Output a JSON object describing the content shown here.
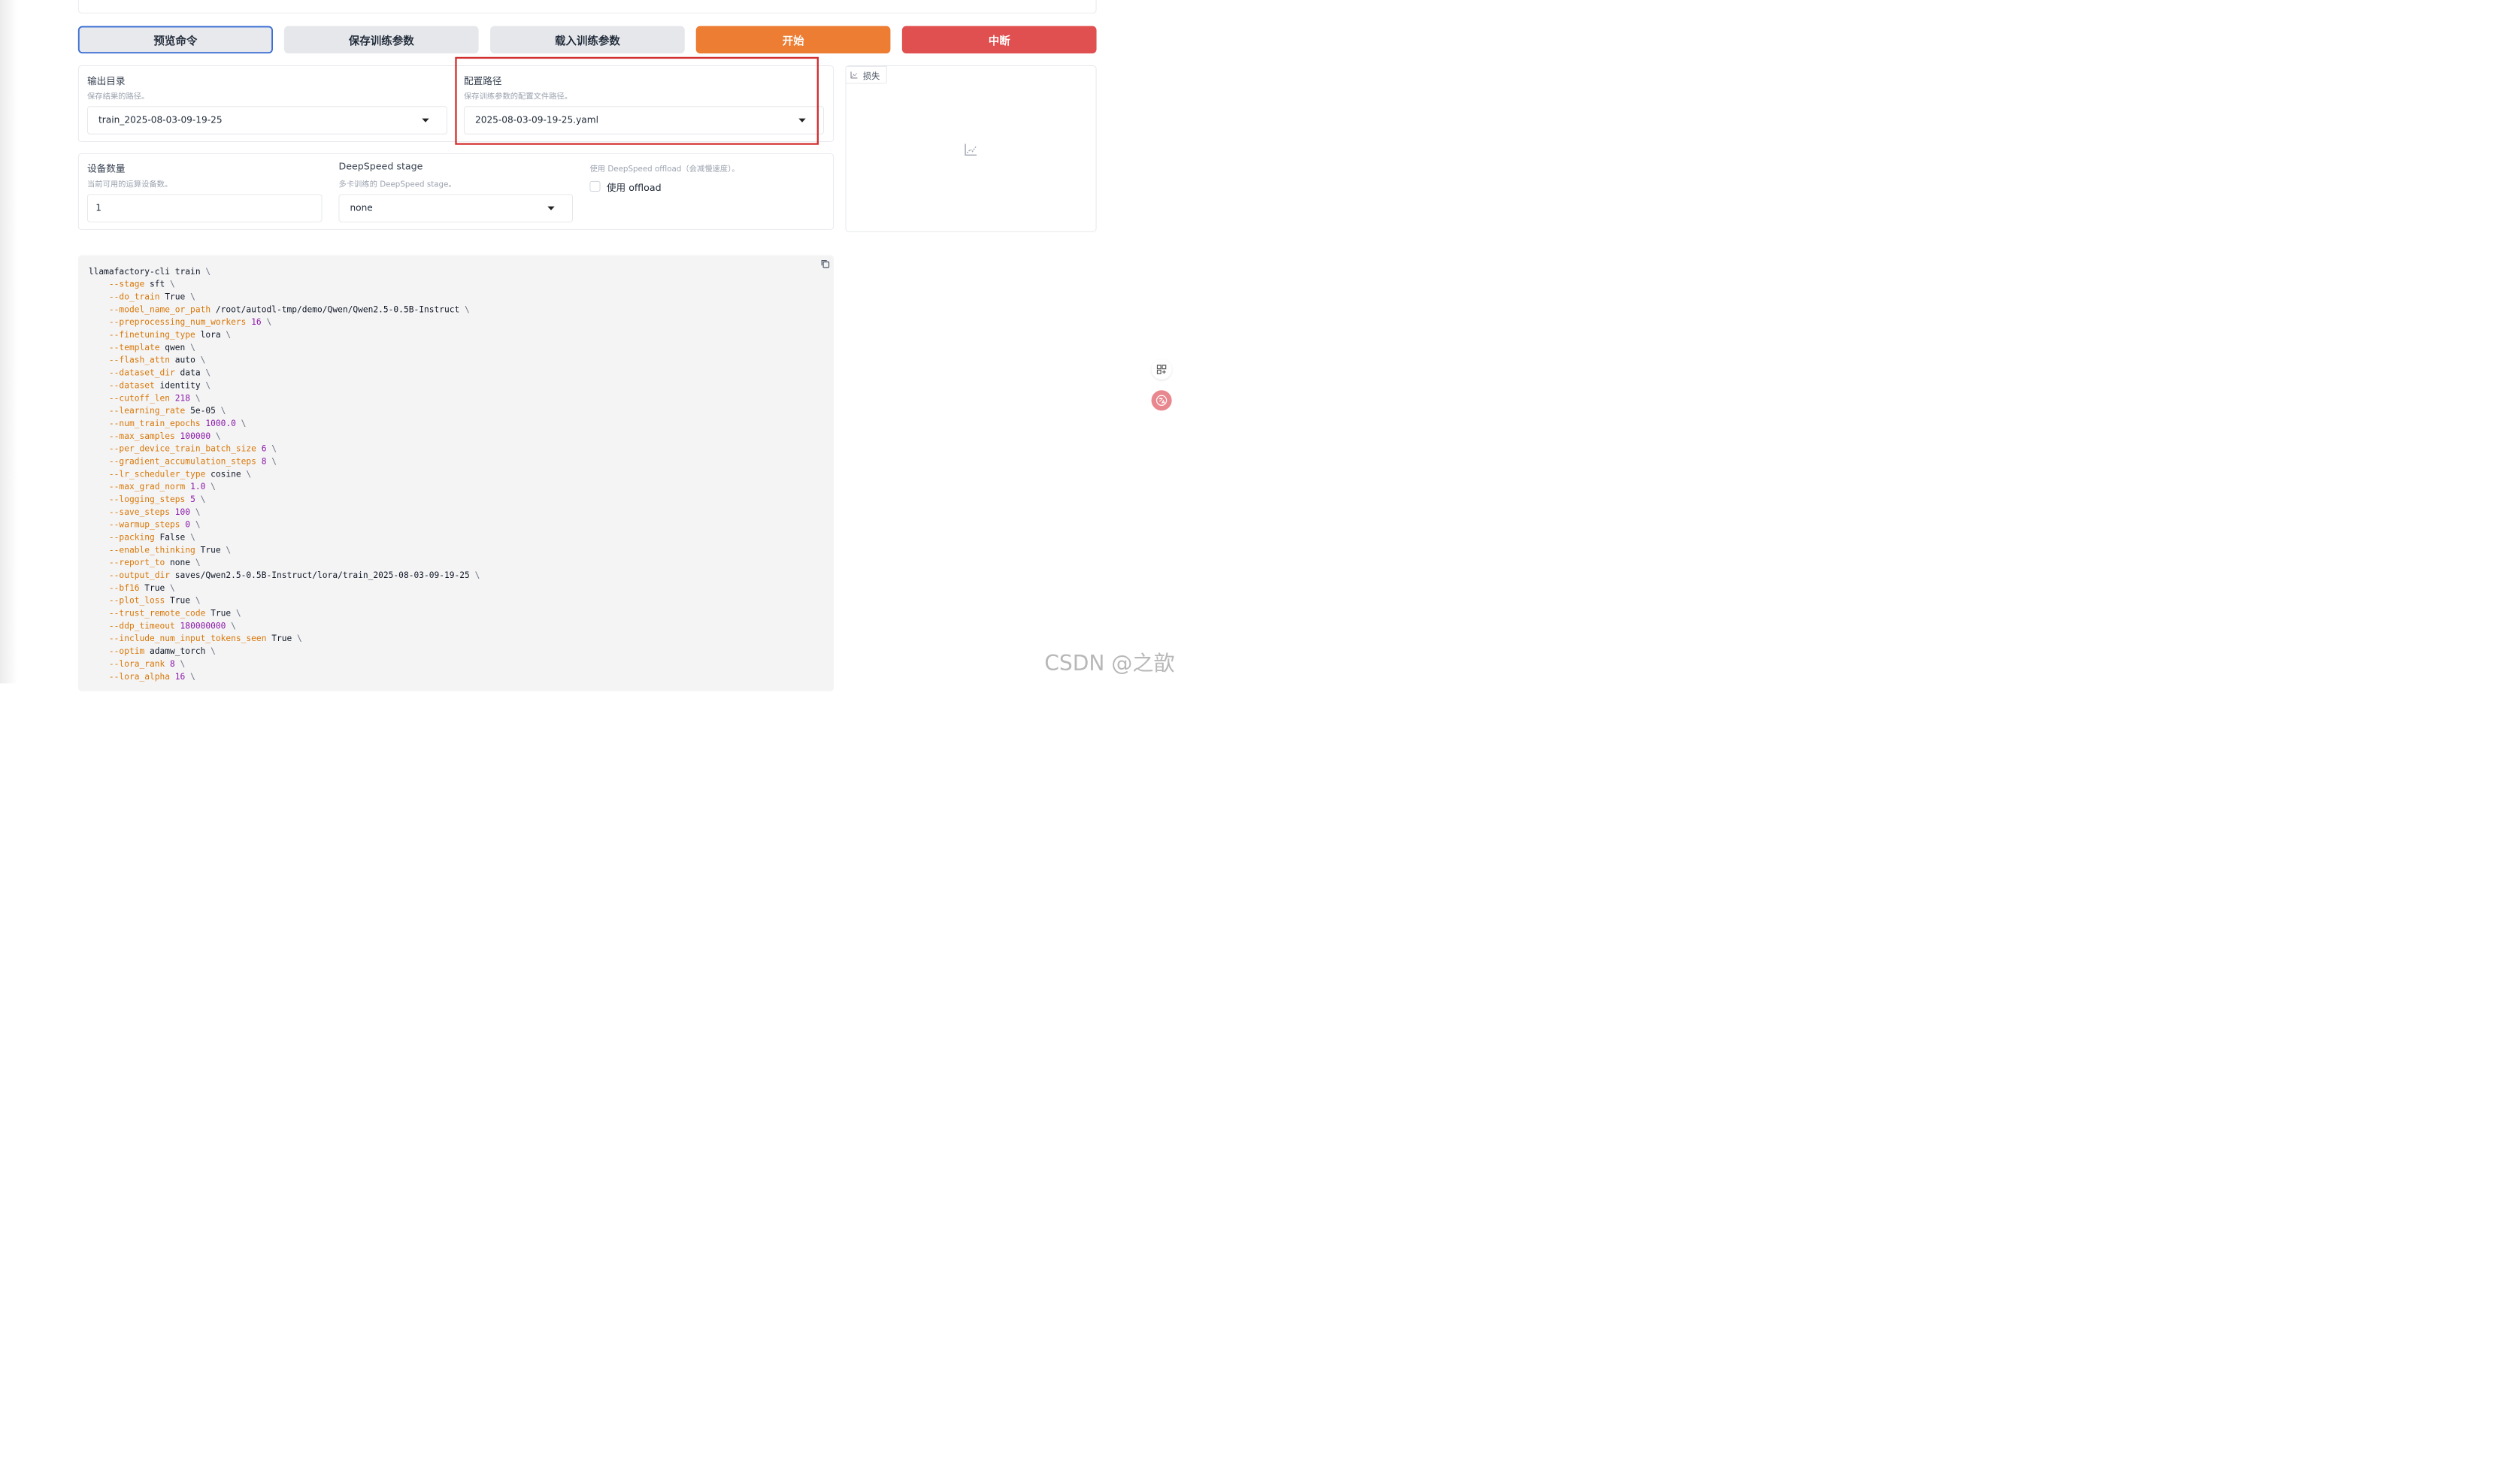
{
  "toolbar": {
    "preview_label": "预览命令",
    "save_label": "保存训练参数",
    "load_label": "载入训练参数",
    "start_label": "开始",
    "stop_label": "中断"
  },
  "output_dir": {
    "label": "输出目录",
    "help": "保存结果的路径。",
    "value": "train_2025-08-03-09-19-25"
  },
  "config_path": {
    "label": "配置路径",
    "help": "保存训练参数的配置文件路径。",
    "value": "2025-08-03-09-19-25.yaml"
  },
  "device_count": {
    "label": "设备数量",
    "help": "当前可用的运算设备数。",
    "value": "1"
  },
  "deepspeed_stage": {
    "label": "DeepSpeed stage",
    "help": "多卡训练的 DeepSpeed stage。",
    "value": "none"
  },
  "offload": {
    "help": "使用 DeepSpeed offload（会减慢速度）。",
    "label": "使用 offload",
    "checked": false
  },
  "loss_panel": {
    "tab_label": "损失"
  },
  "command": {
    "first_line": "llamafactory-cli train",
    "args": [
      {
        "flag": "--stage",
        "value": "sft",
        "numeric": false
      },
      {
        "flag": "--do_train",
        "value": "True",
        "numeric": false
      },
      {
        "flag": "--model_name_or_path",
        "value": "/root/autodl-tmp/demo/Qwen/Qwen2.5-0.5B-Instruct",
        "numeric": false
      },
      {
        "flag": "--preprocessing_num_workers",
        "value": "16",
        "numeric": true
      },
      {
        "flag": "--finetuning_type",
        "value": "lora",
        "numeric": false
      },
      {
        "flag": "--template",
        "value": "qwen",
        "numeric": false
      },
      {
        "flag": "--flash_attn",
        "value": "auto",
        "numeric": false
      },
      {
        "flag": "--dataset_dir",
        "value": "data",
        "numeric": false
      },
      {
        "flag": "--dataset",
        "value": "identity",
        "numeric": false
      },
      {
        "flag": "--cutoff_len",
        "value": "218",
        "numeric": true
      },
      {
        "flag": "--learning_rate",
        "value": "5e-05",
        "numeric": false
      },
      {
        "flag": "--num_train_epochs",
        "value": "1000.0",
        "numeric": true
      },
      {
        "flag": "--max_samples",
        "value": "100000",
        "numeric": true
      },
      {
        "flag": "--per_device_train_batch_size",
        "value": "6",
        "numeric": true
      },
      {
        "flag": "--gradient_accumulation_steps",
        "value": "8",
        "numeric": true
      },
      {
        "flag": "--lr_scheduler_type",
        "value": "cosine",
        "numeric": false
      },
      {
        "flag": "--max_grad_norm",
        "value": "1.0",
        "numeric": true
      },
      {
        "flag": "--logging_steps",
        "value": "5",
        "numeric": true
      },
      {
        "flag": "--save_steps",
        "value": "100",
        "numeric": true
      },
      {
        "flag": "--warmup_steps",
        "value": "0",
        "numeric": true
      },
      {
        "flag": "--packing",
        "value": "False",
        "numeric": false
      },
      {
        "flag": "--enable_thinking",
        "value": "True",
        "numeric": false
      },
      {
        "flag": "--report_to",
        "value": "none",
        "numeric": false
      },
      {
        "flag": "--output_dir",
        "value": "saves/Qwen2.5-0.5B-Instruct/lora/train_2025-08-03-09-19-25",
        "numeric": false
      },
      {
        "flag": "--bf16",
        "value": "True",
        "numeric": false
      },
      {
        "flag": "--plot_loss",
        "value": "True",
        "numeric": false
      },
      {
        "flag": "--trust_remote_code",
        "value": "True",
        "numeric": false
      },
      {
        "flag": "--ddp_timeout",
        "value": "180000000",
        "numeric": true
      },
      {
        "flag": "--include_num_input_tokens_seen",
        "value": "True",
        "numeric": false
      },
      {
        "flag": "--optim",
        "value": "adamw_torch",
        "numeric": false
      },
      {
        "flag": "--lora_rank",
        "value": "8",
        "numeric": true
      },
      {
        "flag": "--lora_alpha",
        "value": "16",
        "numeric": true
      }
    ]
  },
  "watermark": "CSDN @之歆",
  "colors": {
    "primary_border": "#3b6fd4",
    "start": "#ec7d33",
    "stop": "#e05050",
    "highlight": "#d32f2f",
    "flag": "#d97706",
    "number": "#8b1aa8"
  },
  "icons": [
    "chart-icon",
    "copy-icon",
    "grid-icon",
    "translate-icon"
  ]
}
